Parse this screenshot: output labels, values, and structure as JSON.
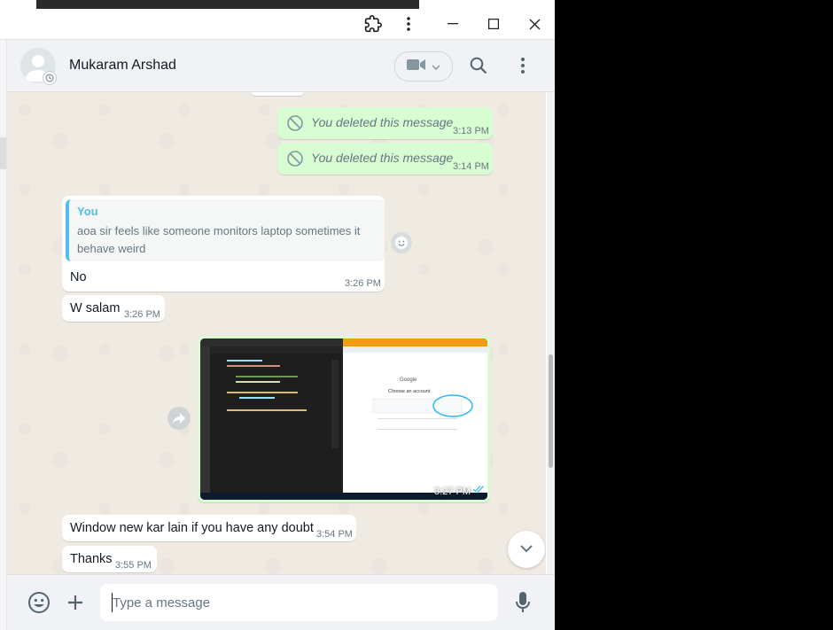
{
  "chat": {
    "contact_name": "Mukaram Arshad"
  },
  "messages": {
    "deleted_1": {
      "text": "You deleted this message",
      "time": "3:13 PM"
    },
    "deleted_2": {
      "text": "You deleted this message",
      "time": "3:14 PM"
    },
    "reply": {
      "quote_author": "You",
      "quote_text": "aoa sir feels like someone monitors laptop sometimes it behave weird",
      "text": "No",
      "time": "3:26 PM"
    },
    "w_salam": {
      "text": "W salam",
      "time": "3:26 PM"
    },
    "image": {
      "time": "3:27 PM",
      "screenshot_heading": "Choose an account",
      "screenshot_brand": "Google"
    },
    "window_new": {
      "text": "Window new kar lain if you have any doubt",
      "time": "3:54 PM"
    },
    "thanks": {
      "text": "Thanks",
      "time": "3:55 PM"
    }
  },
  "composer": {
    "placeholder": "Type a message"
  },
  "colors": {
    "outgoing_bubble": "#d9fdd3",
    "incoming_bubble": "#ffffff",
    "chat_background": "#efeae2",
    "header_background": "#f0f2f5",
    "quote_accent": "#53bdeb"
  },
  "icons": {
    "titlebar": [
      "extension-icon",
      "more-vertical-icon",
      "minimize-icon",
      "maximize-icon",
      "close-icon"
    ],
    "header": [
      "video-call-icon",
      "chevron-down-icon",
      "search-icon",
      "menu-icon"
    ],
    "composer": [
      "emoji-icon",
      "attach-icon",
      "microphone-icon"
    ]
  }
}
